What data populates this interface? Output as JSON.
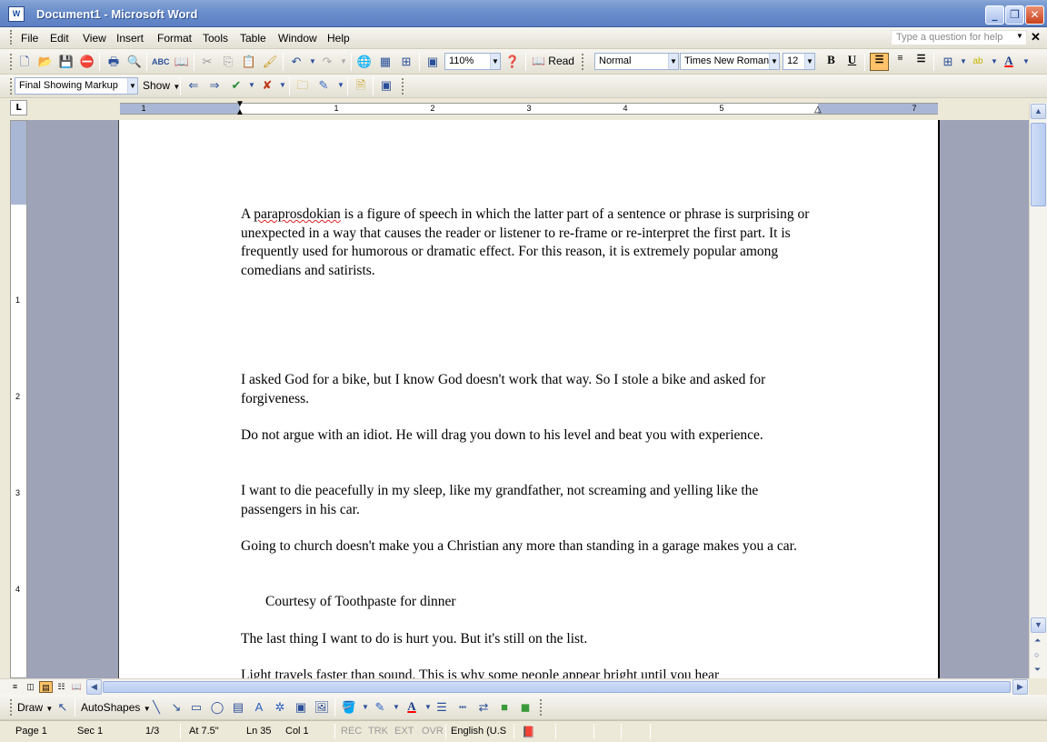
{
  "window": {
    "title": "Document1 - Microsoft Word",
    "app_icon_text": "W"
  },
  "menu": {
    "items": [
      "File",
      "Edit",
      "View",
      "Insert",
      "Format",
      "Tools",
      "Table",
      "Window",
      "Help"
    ],
    "help_placeholder": "Type a question for help"
  },
  "standard_toolbar": {
    "zoom": "110%",
    "read_label": "Read"
  },
  "formatting_toolbar": {
    "style": "Normal",
    "font": "Times New Roman",
    "size": "12",
    "bold": "B",
    "underline": "U"
  },
  "reviewing_toolbar": {
    "display": "Final Showing Markup",
    "show_label": "Show"
  },
  "ruler": {
    "h_numbers": [
      "1",
      "1",
      "2",
      "3",
      "4",
      "5",
      "7"
    ],
    "v_numbers": [
      "1",
      "2",
      "3",
      "4"
    ],
    "corner": "L"
  },
  "document": {
    "paragraphs": [
      {
        "pre": "A ",
        "squiggle": "paraprosdokian",
        "post": " is a figure of speech in which the latter part of a sentence or phrase is surprising or unexpected in a way that causes the reader or listener to re-frame or re-interpret the first part. It is frequently used for humorous or dramatic effect. For this reason, it is extremely popular among comedians and satirists."
      },
      {
        "text": "I asked God for a bike, but I know God doesn't work that way. So I stole a bike and asked for forgiveness."
      },
      {
        "text": "Do not argue with an idiot. He will drag you down to his level and beat you with experience."
      },
      {
        "text": "I want to die peacefully in my sleep, like my grandfather, not screaming and yelling like the passengers in his car."
      },
      {
        "text": "Going to church doesn't make you a Christian any more than standing in a garage makes you a car."
      },
      {
        "text": "Courtesy of Toothpaste for dinner"
      },
      {
        "text": "The last thing I want to do is hurt you. But it's still on the list."
      },
      {
        "text": "Light travels faster than sound. This is why some people appear bright until you hear"
      }
    ]
  },
  "drawing_toolbar": {
    "draw_label": "Draw",
    "autoshapes_label": "AutoShapes"
  },
  "status": {
    "page": "Page 1",
    "sec": "Sec 1",
    "pages": "1/3",
    "at": "At 7.5\"",
    "ln": "Ln 35",
    "col": "Col 1",
    "rec": "REC",
    "trk": "TRK",
    "ext": "EXT",
    "ovr": "OVR",
    "language": "English (U.S"
  },
  "colors": {
    "accent": "#5b7fc2",
    "page_bg": "#9ea3b7",
    "active_button": "#ffc36a"
  }
}
